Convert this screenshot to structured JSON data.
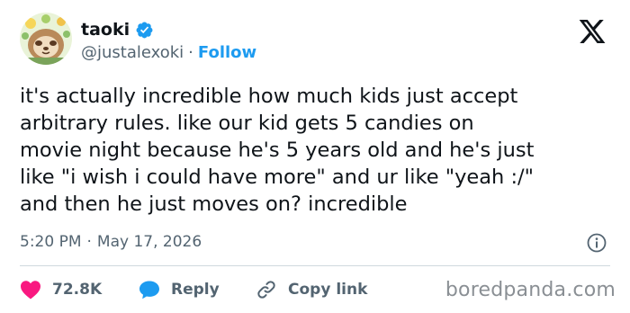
{
  "author": {
    "display_name": "taoki",
    "handle": "@justalexoki",
    "separator": "·",
    "follow_label": "Follow",
    "verified_color": "#1d9bf0"
  },
  "tweet": {
    "lines": [
      "it's actually incredible how much kids just accept",
      "arbitrary rules. like our kid gets 5 candies on",
      "movie night because he's 5 years old and he's just",
      "like \"i wish i could have more\" and ur like \"yeah :/\"",
      "and then he just moves on? incredible"
    ],
    "time": "5:20 PM",
    "separator": "·",
    "date": "May 17, 2026"
  },
  "actions": {
    "likes": "72.8K",
    "reply_label": "Reply",
    "copy_link_label": "Copy link"
  },
  "watermark": "boredpanda.com",
  "colors": {
    "like": "#f91880",
    "accent": "#1d9bf0",
    "muted": "#536471"
  }
}
